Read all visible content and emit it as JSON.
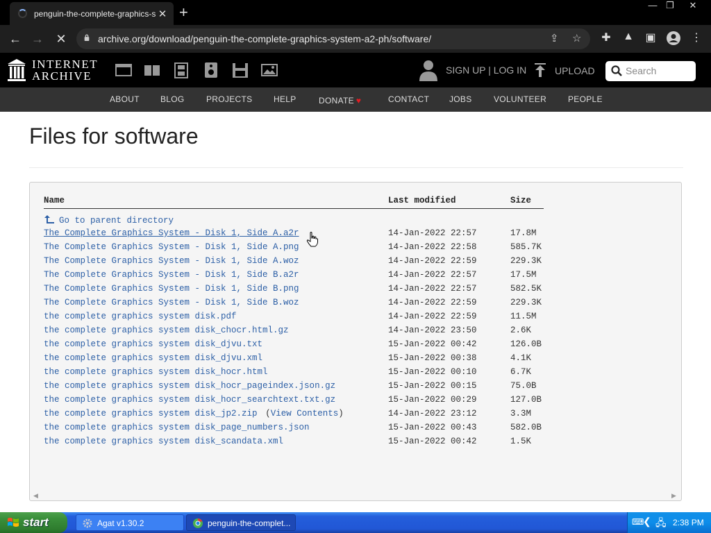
{
  "browser": {
    "tab_title": "penguin-the-complete-graphics-sys",
    "url": "archive.org/download/penguin-the-complete-graphics-system-a2-ph/software/"
  },
  "ia": {
    "wordmark_line1": "INTERNET",
    "wordmark_line2": "ARCHIVE",
    "signup": "SIGN UP | LOG IN",
    "upload": "UPLOAD",
    "search_placeholder": "Search",
    "nav": [
      "ABOUT",
      "BLOG",
      "PROJECTS",
      "HELP",
      "DONATE",
      "CONTACT",
      "JOBS",
      "VOLUNTEER",
      "PEOPLE"
    ]
  },
  "page": {
    "title": "Files for software",
    "col_name": "Name",
    "col_modified": "Last modified",
    "col_size": "Size",
    "parent_link": "Go to parent directory",
    "files": [
      {
        "name": "The Complete Graphics System - Disk 1, Side A.a2r",
        "extra": "",
        "date": "14-Jan-2022 22:57",
        "size": "17.8M"
      },
      {
        "name": "The Complete Graphics System - Disk 1, Side A.png",
        "extra": "",
        "date": "14-Jan-2022 22:58",
        "size": "585.7K"
      },
      {
        "name": "The Complete Graphics System - Disk 1, Side A.woz",
        "extra": "",
        "date": "14-Jan-2022 22:59",
        "size": "229.3K"
      },
      {
        "name": "The Complete Graphics System - Disk 1, Side B.a2r",
        "extra": "",
        "date": "14-Jan-2022 22:57",
        "size": "17.5M"
      },
      {
        "name": "The Complete Graphics System - Disk 1, Side B.png",
        "extra": "",
        "date": "14-Jan-2022 22:57",
        "size": "582.5K"
      },
      {
        "name": "The Complete Graphics System - Disk 1, Side B.woz",
        "extra": "",
        "date": "14-Jan-2022 22:59",
        "size": "229.3K"
      },
      {
        "name": "the complete graphics system disk.pdf",
        "extra": "",
        "date": "14-Jan-2022 22:59",
        "size": "11.5M"
      },
      {
        "name": "the complete graphics system disk_chocr.html.gz",
        "extra": "",
        "date": "14-Jan-2022 23:50",
        "size": "2.6K"
      },
      {
        "name": "the complete graphics system disk_djvu.txt",
        "extra": "",
        "date": "15-Jan-2022 00:42",
        "size": "126.0B"
      },
      {
        "name": "the complete graphics system disk_djvu.xml",
        "extra": "",
        "date": "15-Jan-2022 00:38",
        "size": "4.1K"
      },
      {
        "name": "the complete graphics system disk_hocr.html",
        "extra": "",
        "date": "15-Jan-2022 00:10",
        "size": "6.7K"
      },
      {
        "name": "the complete graphics system disk_hocr_pageindex.json.gz",
        "extra": "",
        "date": "15-Jan-2022 00:15",
        "size": "75.0B"
      },
      {
        "name": "the complete graphics system disk_hocr_searchtext.txt.gz",
        "extra": "",
        "date": "15-Jan-2022 00:29",
        "size": "127.0B"
      },
      {
        "name": "the complete graphics system disk_jp2.zip",
        "extra": "View Contents",
        "date": "14-Jan-2022 23:12",
        "size": "3.3M"
      },
      {
        "name": "the complete graphics system disk_page_numbers.json",
        "extra": "",
        "date": "15-Jan-2022 00:43",
        "size": "582.0B"
      },
      {
        "name": "the complete graphics system disk_scandata.xml",
        "extra": "",
        "date": "15-Jan-2022 00:42",
        "size": "1.5K"
      }
    ]
  },
  "taskbar": {
    "start": "start",
    "task1": "Agat v1.30.2",
    "task2": "penguin-the-complet...",
    "clock": "2:38 PM"
  }
}
